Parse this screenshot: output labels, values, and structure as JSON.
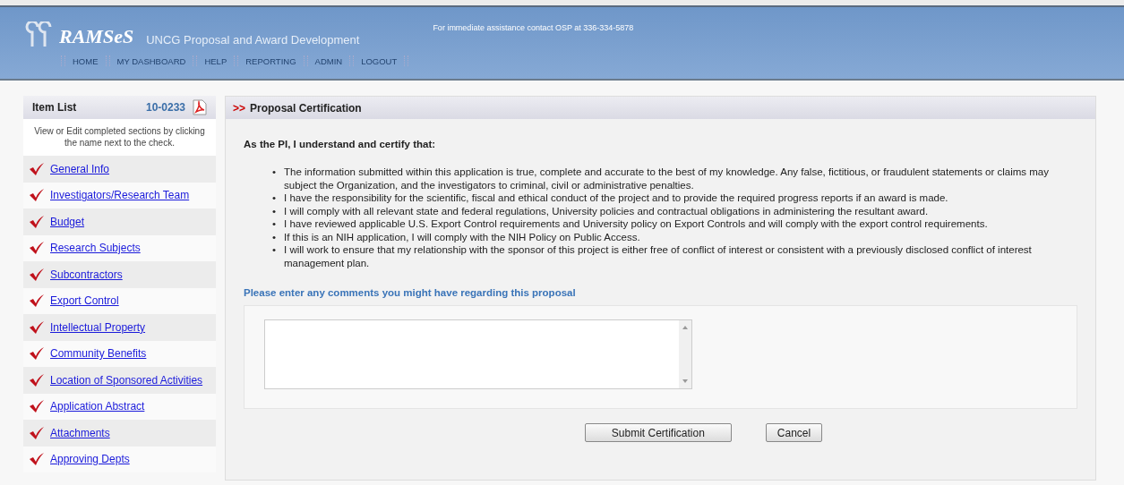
{
  "header": {
    "logo": "RAMSeS",
    "subtitle": "UNCG Proposal and Award Development",
    "assistance": "For immediate assistance contact OSP at 336-334-5878",
    "nav": [
      "HOME",
      "MY DASHBOARD",
      "HELP",
      "REPORTING",
      "ADMIN",
      "LOGOUT"
    ]
  },
  "sidebar": {
    "title": "Item List",
    "proposal_number": "10-0233",
    "hint": "View or Edit completed sections by clicking the name next to the check.",
    "items": [
      {
        "label": "General Info",
        "checked": true
      },
      {
        "label": "Investigators/Research Team",
        "checked": true
      },
      {
        "label": "Budget",
        "checked": true
      },
      {
        "label": "Research Subjects",
        "checked": true
      },
      {
        "label": "Subcontractors",
        "checked": true
      },
      {
        "label": "Export Control",
        "checked": true
      },
      {
        "label": "Intellectual Property",
        "checked": true
      },
      {
        "label": "Community Benefits",
        "checked": true
      },
      {
        "label": "Location of Sponsored Activities",
        "checked": true
      },
      {
        "label": "Application Abstract",
        "checked": true
      },
      {
        "label": "Attachments",
        "checked": true
      },
      {
        "label": "Approving Depts",
        "checked": true
      }
    ]
  },
  "panel": {
    "marker": ">>",
    "title": "Proposal Certification",
    "intro": "As the PI, I understand and certify that:",
    "bullet": "•",
    "statements": [
      "The information submitted within this application is true, complete and accurate to the best of my knowledge. Any false, fictitious, or fraudulent statements or claims may subject the Organization, and the investigators to criminal, civil or administrative penalties.",
      "I have the responsibility for the scientific, fiscal and ethical conduct of the project and to provide the required progress reports if an award is made.",
      "I will comply with all relevant state and federal regulations, University policies and contractual obligations in administering the resultant award.",
      "I have reviewed applicable U.S. Export Control requirements and University policy on Export Controls and will comply with the export control requirements.",
      "If this is an NIH application, I will comply with the NIH Policy on Public Access.",
      "I will work to ensure that my relationship with the sponsor of this project is either free of conflict of interest or consistent with a previously disclosed conflict of interest management plan."
    ],
    "comments_label": "Please enter any comments you might have regarding this proposal",
    "buttons": [
      "Submit Certification",
      "Cancel"
    ]
  }
}
